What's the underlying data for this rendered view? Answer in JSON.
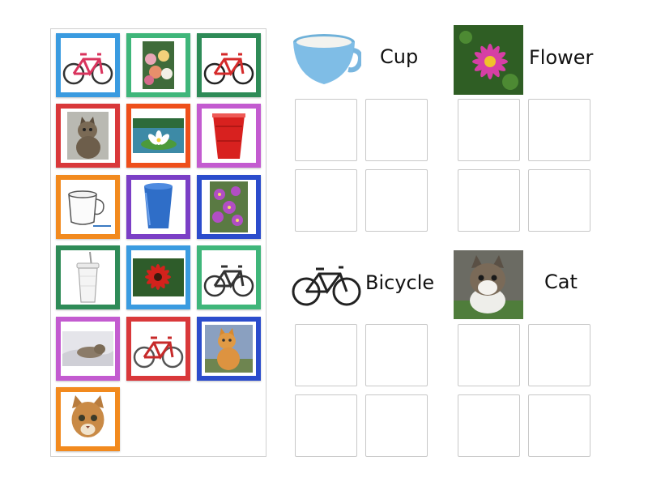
{
  "categories": [
    {
      "id": "cup",
      "label": "Cup",
      "image": "blue-cup"
    },
    {
      "id": "flower",
      "label": "Flower",
      "image": "pink-dahlia-flower"
    },
    {
      "id": "bicycle",
      "label": "Bicycle",
      "image": "black-bicycle"
    },
    {
      "id": "cat",
      "label": "Cat",
      "image": "tabby-kitten"
    }
  ],
  "cards": [
    {
      "image": "kids-bicycle",
      "border": "#3a9be0"
    },
    {
      "image": "rose-bouquet",
      "border": "#3fb67a"
    },
    {
      "image": "red-mountain-bike",
      "border": "#2e8b57"
    },
    {
      "image": "tabby-cat",
      "border": "#d9383a"
    },
    {
      "image": "water-lily",
      "border": "#ee4f1b"
    },
    {
      "image": "red-plastic-cup",
      "border": "#c35bd0"
    },
    {
      "image": "white-cup-sketch",
      "border": "#f28a1e"
    },
    {
      "image": "blue-plastic-cup",
      "border": "#7b3fc6"
    },
    {
      "image": "purple-flowers",
      "border": "#2b4ccc"
    },
    {
      "image": "tumbler-with-straw",
      "border": "#2e8b57"
    },
    {
      "image": "red-gerbera",
      "border": "#3a9be0"
    },
    {
      "image": "cruiser-bicycle",
      "border": "#3fb67a"
    },
    {
      "image": "cat-on-blanket",
      "border": "#c35bd0"
    },
    {
      "image": "red-city-bicycle",
      "border": "#d9383a"
    },
    {
      "image": "orange-cat",
      "border": "#2b4ccc"
    },
    {
      "image": "cat-face",
      "border": "#f28a1e"
    }
  ]
}
